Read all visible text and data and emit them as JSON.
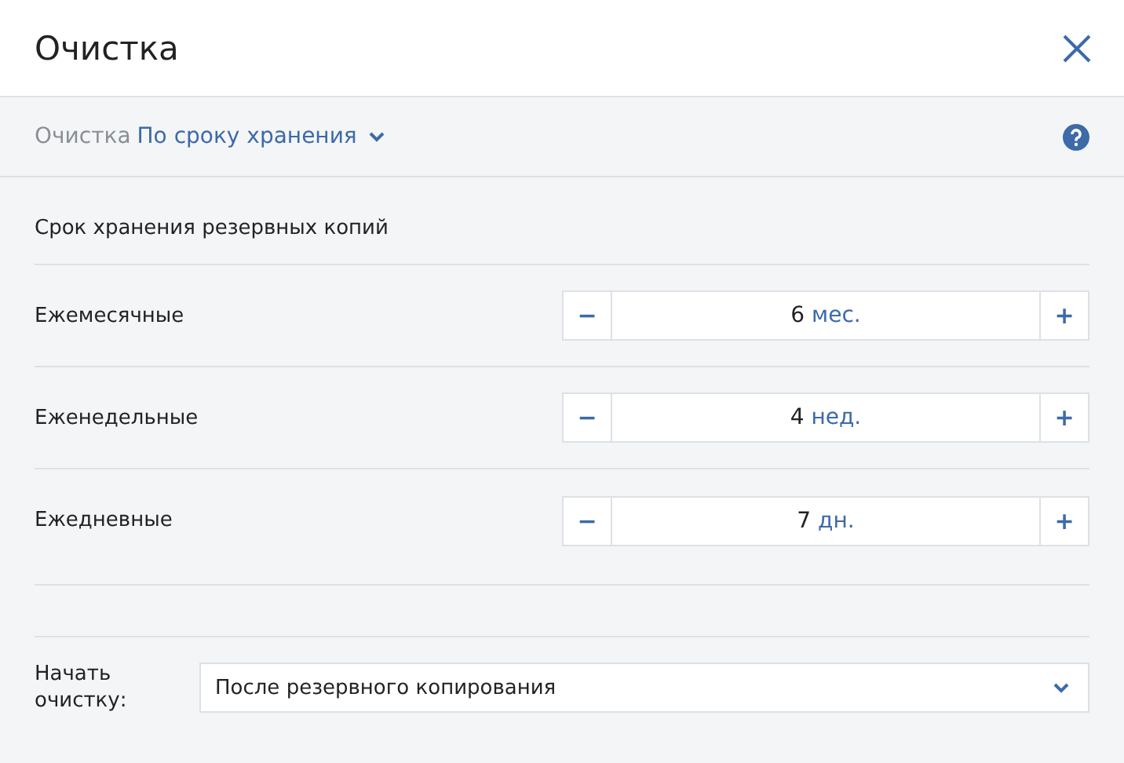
{
  "window": {
    "title": "Очистка"
  },
  "mode": {
    "label": "Очистка",
    "value": "По сроку хранения"
  },
  "section_title": "Срок хранения резервных копий",
  "retention": [
    {
      "label": "Ежемесячные",
      "minus": "−",
      "amount": "6",
      "unit": "мес.",
      "plus": "+"
    },
    {
      "label": "Еженедельные",
      "minus": "−",
      "amount": "4",
      "unit": "нед.",
      "plus": "+"
    },
    {
      "label": "Ежедневные",
      "minus": "−",
      "amount": "7",
      "unit": "дн.",
      "plus": "+"
    }
  ],
  "start": {
    "label": "Начать очистку:",
    "value": "После резервного копирования"
  }
}
